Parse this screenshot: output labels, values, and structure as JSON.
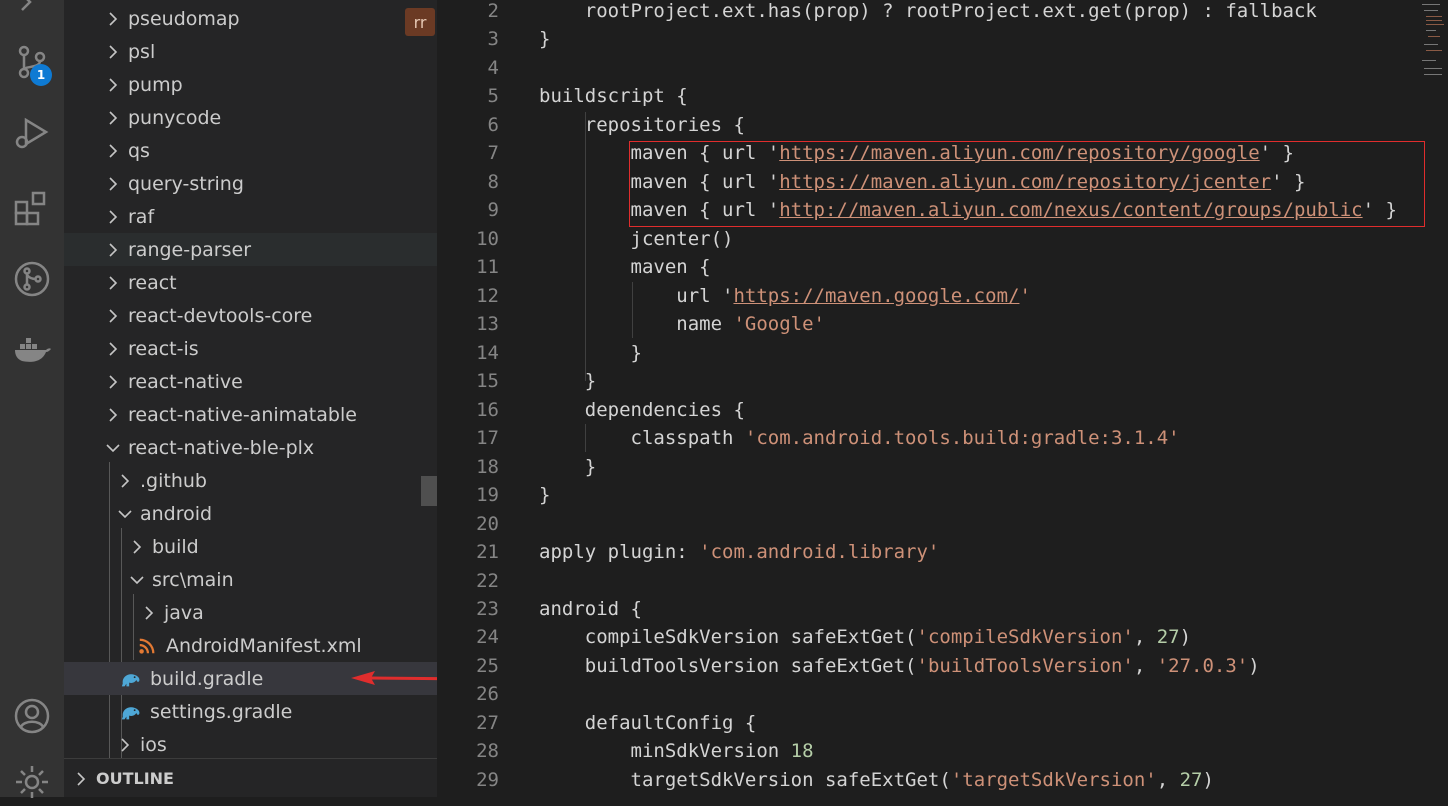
{
  "activity_bar": {
    "icons": [
      "explorer-icon",
      "source-control-icon",
      "run-debug-icon",
      "extensions-icon",
      "git-graph-icon",
      "docker-icon",
      "account-icon",
      "settings-gear-icon"
    ],
    "source_control_badge": "1"
  },
  "explorer": {
    "rr_badge": "rr",
    "tree": [
      {
        "label": "pseudomap",
        "expanded": false
      },
      {
        "label": "psl",
        "expanded": false
      },
      {
        "label": "pump",
        "expanded": false
      },
      {
        "label": "punycode",
        "expanded": false
      },
      {
        "label": "qs",
        "expanded": false
      },
      {
        "label": "query-string",
        "expanded": false
      },
      {
        "label": "raf",
        "expanded": false
      },
      {
        "label": "range-parser",
        "expanded": false
      },
      {
        "label": "react",
        "expanded": false
      },
      {
        "label": "react-devtools-core",
        "expanded": false
      },
      {
        "label": "react-is",
        "expanded": false
      },
      {
        "label": "react-native",
        "expanded": false
      },
      {
        "label": "react-native-animatable",
        "expanded": false
      },
      {
        "label": "react-native-ble-plx",
        "expanded": true
      },
      {
        "label": ".github",
        "expanded": false
      },
      {
        "label": "android",
        "expanded": true
      },
      {
        "label": "build",
        "expanded": false
      },
      {
        "label": "src\\main",
        "expanded": true
      },
      {
        "label": "java",
        "expanded": false
      },
      {
        "label": "AndroidManifest.xml",
        "file": "xml"
      },
      {
        "label": "build.gradle",
        "file": "gradle",
        "selected": true
      },
      {
        "label": "settings.gradle",
        "file": "gradle"
      },
      {
        "label": "ios",
        "expanded": false
      }
    ],
    "outline_label": "OUTLINE"
  },
  "editor": {
    "line_numbers": [
      "2",
      "3",
      "4",
      "5",
      "6",
      "7",
      "8",
      "9",
      "10",
      "11",
      "12",
      "13",
      "14",
      "15",
      "16",
      "17",
      "18",
      "19",
      "20",
      "21",
      "22",
      "23",
      "24",
      "25",
      "26",
      "27",
      "28",
      "29"
    ],
    "lines": {
      "l2": "    rootProject.ext.has(prop) ? rootProject.ext.get(prop) : fallback",
      "l3": "}",
      "l5": "buildscript {",
      "l6": "    repositories {",
      "l7a": "        maven { url '",
      "l7u": "https://maven.aliyun.com/repository/google",
      "l7b": "' }",
      "l8a": "        maven { url '",
      "l8u": "https://maven.aliyun.com/repository/jcenter",
      "l8b": "' }",
      "l9a": "        maven { url '",
      "l9u": "http://maven.aliyun.com/nexus/content/groups/public",
      "l9b": "' }",
      "l10": "        jcenter()",
      "l11": "        maven {",
      "l12a": "            url '",
      "l12u": "https://maven.google.com/",
      "l12b": "'",
      "l13a": "            name ",
      "l13s": "'Google'",
      "l14": "        }",
      "l15": "    }",
      "l16": "    dependencies {",
      "l17a": "        classpath ",
      "l17s": "'com.android.tools.build:gradle:3.1.4'",
      "l18": "    }",
      "l19": "}",
      "l21a": "apply plugin: ",
      "l21s": "'com.android.library'",
      "l23": "android {",
      "l24a": "    compileSdkVersion safeExtGet(",
      "l24s": "'compileSdkVersion'",
      "l24b": ", ",
      "l24n": "27",
      "l24c": ")",
      "l25a": "    buildToolsVersion safeExtGet(",
      "l25s": "'buildToolsVersion'",
      "l25b": ", ",
      "l25s2": "'27.0.3'",
      "l25c": ")",
      "l27": "    defaultConfig {",
      "l28a": "        minSdkVersion ",
      "l28n": "18",
      "l29a": "        targetSdkVersion safeExtGet(",
      "l29s": "'targetSdkVersion'",
      "l29b": ", ",
      "l29n": "27",
      "l29c": ")"
    }
  },
  "colors": {
    "highlight_box": "#e02d2d",
    "arrow": "#e02d2d",
    "string": "#ce9178",
    "number": "#b5cea8"
  }
}
